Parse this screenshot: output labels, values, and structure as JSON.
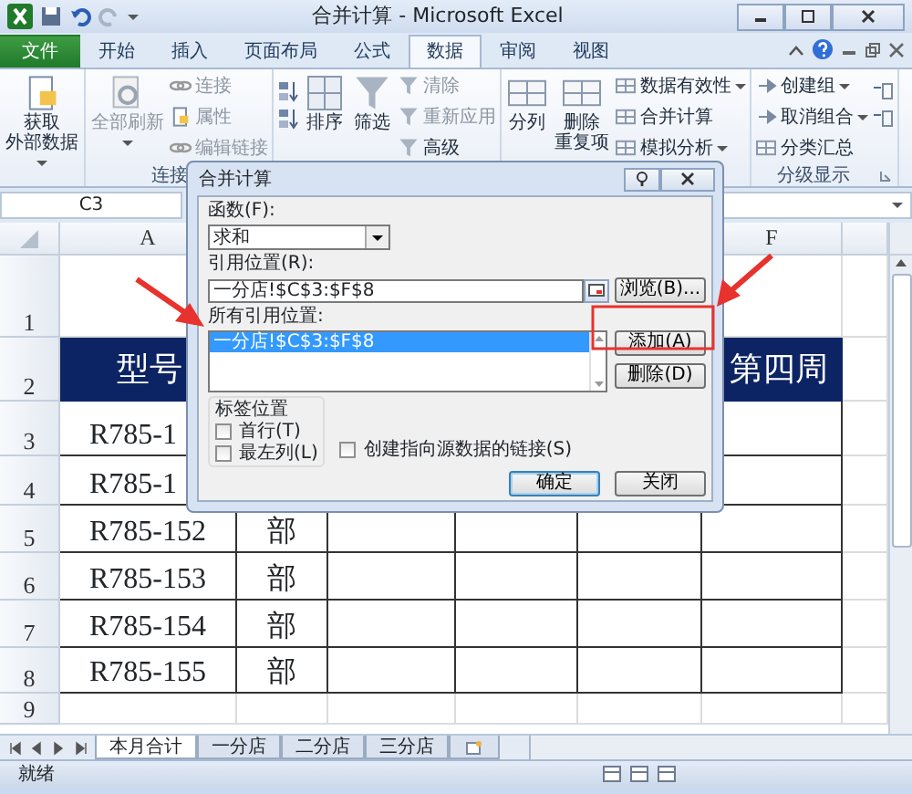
{
  "window": {
    "title": "合并计算 - Microsoft Excel"
  },
  "ribbon_tabs": [
    {
      "label": "文件",
      "kind": "file",
      "selected": false
    },
    {
      "label": "开始",
      "kind": "tab",
      "selected": false
    },
    {
      "label": "插入",
      "kind": "tab",
      "selected": false
    },
    {
      "label": "页面布局",
      "kind": "tab",
      "selected": false
    },
    {
      "label": "公式",
      "kind": "tab",
      "selected": false
    },
    {
      "label": "数据",
      "kind": "tab",
      "selected": true
    },
    {
      "label": "审阅",
      "kind": "tab",
      "selected": false
    },
    {
      "label": "视图",
      "kind": "tab",
      "selected": false
    }
  ],
  "ribbon_groups": [
    {
      "columns": [
        {
          "kind": "large",
          "lines": [
            "获取",
            "外部数据"
          ],
          "dropdown": true,
          "disabled": false
        }
      ]
    },
    {
      "label": "连接",
      "columns": [
        {
          "kind": "large",
          "lines": [
            "全部刷新"
          ],
          "dropdown": true,
          "disabled": true
        },
        {
          "kind": "small",
          "items": [
            {
              "label": "连接",
              "dropdown": false,
              "disabled": true
            },
            {
              "label": "属性",
              "dropdown": false,
              "disabled": true
            },
            {
              "label": "编辑链接",
              "dropdown": false,
              "disabled": true
            }
          ]
        }
      ]
    },
    {
      "columns": [
        {
          "kind": "icons"
        },
        {
          "kind": "large",
          "lines": [
            "排序"
          ],
          "dropdown": false,
          "disabled": false
        },
        {
          "kind": "large",
          "lines": [
            "筛选"
          ],
          "dropdown": false,
          "disabled": false
        },
        {
          "kind": "small",
          "items": [
            {
              "label": "清除",
              "dropdown": false,
              "disabled": true
            },
            {
              "label": "重新应用",
              "dropdown": false,
              "disabled": true
            },
            {
              "label": "高级",
              "dropdown": false,
              "disabled": false
            }
          ]
        }
      ]
    },
    {
      "columns": [
        {
          "kind": "large",
          "lines": [
            "分列"
          ],
          "dropdown": false,
          "disabled": false
        },
        {
          "kind": "large",
          "lines": [
            "删除",
            "重复项"
          ],
          "dropdown": false,
          "disabled": false
        },
        {
          "kind": "small",
          "items": [
            {
              "label": "数据有效性",
              "dropdown": true,
              "disabled": false
            },
            {
              "label": "合并计算",
              "dropdown": false,
              "disabled": false
            },
            {
              "label": "模拟分析",
              "dropdown": true,
              "disabled": false
            }
          ]
        }
      ]
    },
    {
      "label": "分级显示",
      "columns": [
        {
          "kind": "small",
          "items": [
            {
              "label": "创建组",
              "dropdown": true,
              "disabled": false
            },
            {
              "label": "取消组合",
              "dropdown": true,
              "disabled": false
            },
            {
              "label": "分类汇总",
              "dropdown": false,
              "disabled": false
            }
          ]
        },
        {
          "kind": "icons"
        }
      ]
    }
  ],
  "formula_bar": {
    "name_box": "C3"
  },
  "sheet": {
    "column_headers": {
      "column_a": "A",
      "column_f": "F"
    },
    "rows": [
      {
        "number": "1",
        "kind": "plain"
      },
      {
        "number": "2",
        "kind": "header",
        "column_a": "型号",
        "column_f": "第四周"
      },
      {
        "number": "3",
        "kind": "data",
        "column_a": "R785-1"
      },
      {
        "number": "4",
        "kind": "data",
        "column_a": "R785-1"
      },
      {
        "number": "5",
        "kind": "data",
        "column_a": "R785-152",
        "column_b": "部"
      },
      {
        "number": "6",
        "kind": "data",
        "column_a": "R785-153",
        "column_b": "部"
      },
      {
        "number": "7",
        "kind": "data",
        "column_a": "R785-154",
        "column_b": "部"
      },
      {
        "number": "8",
        "kind": "data",
        "column_a": "R785-155",
        "column_b": "部"
      },
      {
        "number": "9",
        "kind": "plain"
      }
    ]
  },
  "sheet_tabs": [
    {
      "label": "本月合计",
      "selected": true
    },
    {
      "label": "一分店",
      "selected": false
    },
    {
      "label": "二分店",
      "selected": false
    },
    {
      "label": "三分店",
      "selected": false
    }
  ],
  "status_bar": {
    "text": "就绪"
  },
  "dialog": {
    "title": "合并计算",
    "function_label": "函数(F):",
    "function_value": "求和",
    "reference_label": "引用位置(R):",
    "reference_value": "一分店!$C$3:$F$8",
    "browse_button": "浏览(B)...",
    "all_references_label": "所有引用位置:",
    "all_references": [
      {
        "text": "一分店!$C$3:$F$8",
        "selected": true
      }
    ],
    "add_button": "添加(A)",
    "delete_button": "删除(D)",
    "label_group": "标签位置",
    "label_options": [
      {
        "label": "首行(T)",
        "checked": false
      },
      {
        "label": "最左列(L)",
        "checked": false
      }
    ],
    "link_option": {
      "label": "创建指向源数据的链接(S)",
      "checked": false
    },
    "buttons": [
      {
        "label": "确定",
        "default": true
      },
      {
        "label": "关闭",
        "default": false
      }
    ]
  },
  "annotations": [
    {
      "kind": "arrow"
    },
    {
      "kind": "arrow"
    },
    {
      "kind": "frame"
    }
  ]
}
